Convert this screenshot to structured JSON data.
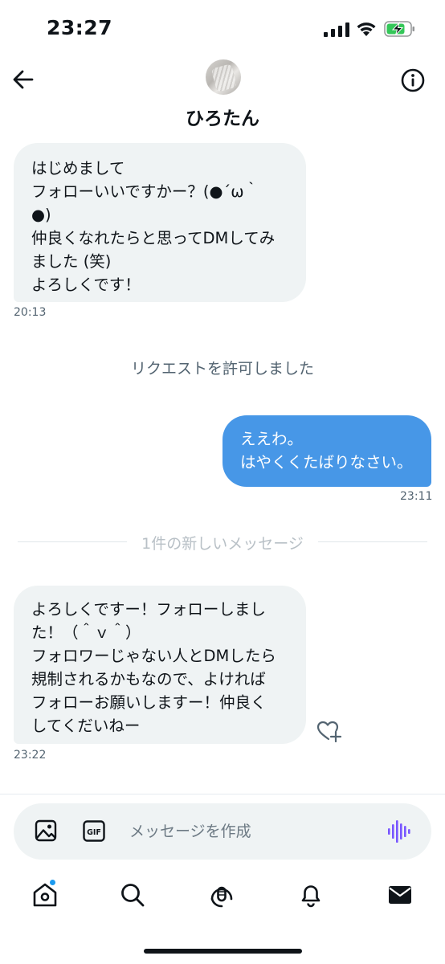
{
  "status_bar": {
    "time": "23:27"
  },
  "header": {
    "display_name": "ひろたん"
  },
  "messages": [
    {
      "direction": "incoming",
      "text": "はじめまして\nフォローいいですかー？(●´ω｀\n●)\n仲良くなれたらと思ってDMしてみ\nました (笑)\nよろしくです！",
      "time": "20:13"
    },
    {
      "direction": "outgoing",
      "text": "ええわ。\nはやくくたばりなさい。",
      "time": "23:11"
    },
    {
      "direction": "incoming",
      "text": "よろしくですー！フォローしまし\nた！（＾ｖ＾）\nフォロワーじゃない人とDMしたら\n規制されるかもなので、よければ\nフォローお願いしますー！仲良く\nしてくだいねー",
      "time": "23:22"
    }
  ],
  "system_note": "リクエストを許可しました",
  "new_messages_divider": "1件の新しいメッセージ",
  "composer": {
    "placeholder": "メッセージを作成"
  },
  "icons": {
    "back": "arrow-left-icon",
    "info": "info-circle-icon",
    "image": "image-icon",
    "gif": "gif-icon",
    "voice": "voice-wave-icon",
    "react": "heart-plus-icon",
    "tabs": [
      "home-icon",
      "search-icon",
      "spaces-icon",
      "bell-icon",
      "envelope-icon"
    ]
  },
  "colors": {
    "outgoing_bubble": "#4797e7",
    "incoming_bubble": "#eff3f4",
    "accent": "#1d9bf0",
    "voice": "#7856ff",
    "battery_charge": "#34c759"
  }
}
